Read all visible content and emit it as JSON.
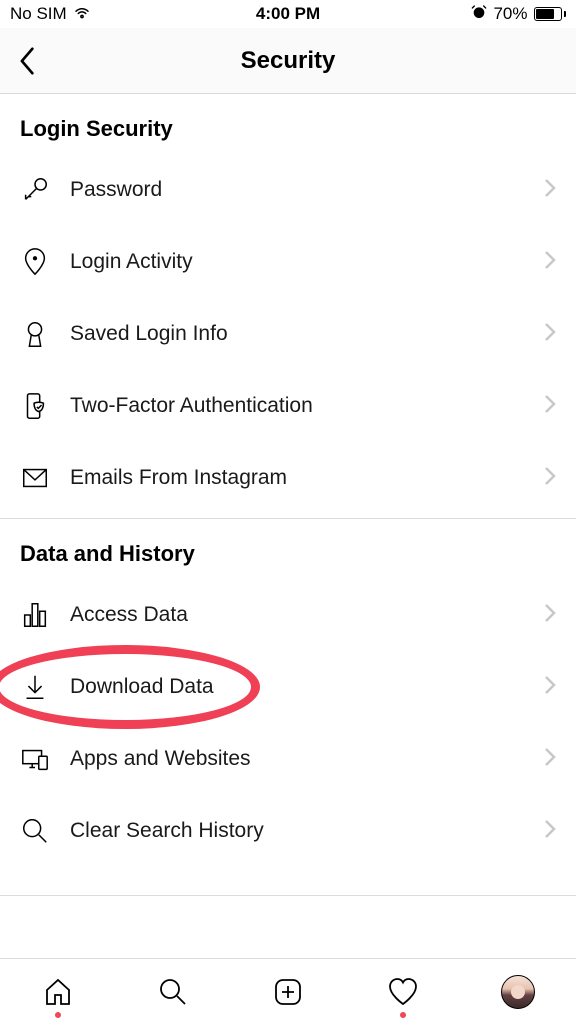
{
  "status": {
    "carrier": "No SIM",
    "time": "4:00 PM",
    "battery_pct": "70%"
  },
  "header": {
    "title": "Security"
  },
  "sections": [
    {
      "title": "Login Security",
      "items": [
        {
          "label": "Password"
        },
        {
          "label": "Login Activity"
        },
        {
          "label": "Saved Login Info"
        },
        {
          "label": "Two-Factor Authentication"
        },
        {
          "label": "Emails From Instagram"
        }
      ]
    },
    {
      "title": "Data and History",
      "items": [
        {
          "label": "Access Data"
        },
        {
          "label": "Download Data"
        },
        {
          "label": "Apps and Websites"
        },
        {
          "label": "Clear Search History"
        }
      ]
    }
  ],
  "annotation": {
    "highlighted_item": "Download Data"
  }
}
